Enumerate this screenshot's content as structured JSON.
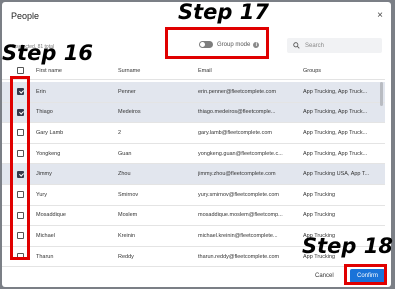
{
  "dialog": {
    "title": "People",
    "close_glyph": "×",
    "selected_count": "5 selected, 81 total"
  },
  "annotations": {
    "step16": "Step 16",
    "step17": "Step 17",
    "step18": "Step 18",
    "highlight_color": "#e00000"
  },
  "toolbar": {
    "group_mode_label": "Group mode",
    "group_mode_on": false,
    "info_glyph": "i",
    "search_placeholder": "Search"
  },
  "table": {
    "columns": [
      "First name",
      "Surname",
      "Email",
      "Groups"
    ],
    "rows": [
      {
        "first": "Erin",
        "surname": "Penner",
        "email": "erin.penner@fleetcomplete.com",
        "groups": "App Trucking, App Truck...",
        "selected": true
      },
      {
        "first": "Thiago",
        "surname": "Medeiros",
        "email": "thiago.medeiros@fleetcomple...",
        "groups": "App Trucking, App Truck...",
        "selected": true
      },
      {
        "first": "Gary Lamb",
        "surname": "2",
        "email": "gary.lamb@fleetcomplete.com",
        "groups": "App Trucking, App Truck...",
        "selected": false
      },
      {
        "first": "Yongkeng",
        "surname": "Guan",
        "email": "yongkeng.guan@fleetcomplete.c...",
        "groups": "App Trucking, App Truck...",
        "selected": false
      },
      {
        "first": "Jimmy",
        "surname": "Zhou",
        "email": "jimmy.zhou@fleetcomplete.com",
        "groups": "App Trucking USA, App T...",
        "selected": true
      },
      {
        "first": "Yury",
        "surname": "Smirnov",
        "email": "yury.smirnov@fleetcomplete.com",
        "groups": "App Trucking",
        "selected": false
      },
      {
        "first": "Mosaddique",
        "surname": "Moslem",
        "email": "mosaddique.moslem@fleetcomp...",
        "groups": "App Trucking",
        "selected": false
      },
      {
        "first": "Michael",
        "surname": "Kreinin",
        "email": "michael.kreinin@fleetcomplete...",
        "groups": "App Trucking",
        "selected": false
      },
      {
        "first": "Tharun",
        "surname": "Reddy",
        "email": "tharun.reddy@fleetcomplete.com",
        "groups": "App Trucking",
        "selected": false
      }
    ]
  },
  "footer": {
    "cancel_label": "Cancel",
    "confirm_label": "Confirm"
  }
}
